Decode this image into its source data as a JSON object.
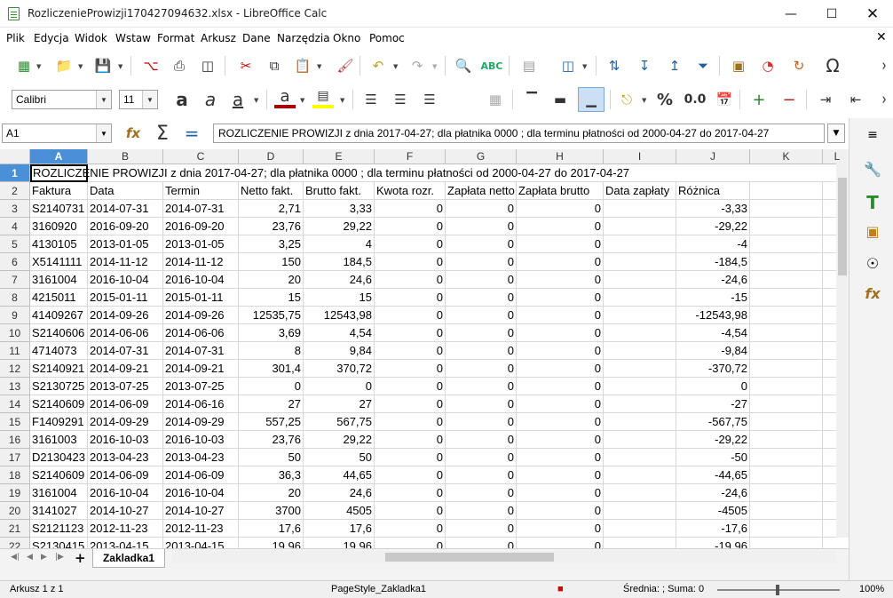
{
  "window": {
    "title": "RozliczenieProwizji170427094632.xlsx - LibreOffice Calc"
  },
  "menu": [
    "Plik",
    "Edycja",
    "Widok",
    "Wstaw",
    "Format",
    "Arkusz",
    "Dane",
    "Narzędzia",
    "Okno",
    "Pomoc"
  ],
  "font": {
    "name": "Calibri",
    "size": "11"
  },
  "namebox": "A1",
  "formula": "ROZLICZENIE PROWIZJI z dnia 2017-04-27; dla płatnika 0000 ; dla terminu płatności od 2000-04-27 do 2017-04-27",
  "columns": [
    "A",
    "B",
    "C",
    "D",
    "E",
    "F",
    "G",
    "H",
    "I",
    "J",
    "K",
    "L"
  ],
  "row1_text": "ROZLICZENIE PROWIZJI z dnia 2017-04-27; dla płatnika 0000 ; dla terminu płatności od 2000-04-27 do 2017-04-27",
  "headers": [
    "Faktura",
    "Data",
    "Termin",
    "Netto fakt.",
    "Brutto fakt.",
    "Kwota rozr.",
    "Zapłata netto",
    "Zapłata brutto",
    "Data zapłaty",
    "Różnica"
  ],
  "rows": [
    [
      "S2140731",
      "2014-07-31",
      "2014-07-31",
      "2,71",
      "3,33",
      "0",
      "0",
      "0",
      "",
      "-3,33"
    ],
    [
      "3160920",
      "2016-09-20",
      "2016-09-20",
      "23,76",
      "29,22",
      "0",
      "0",
      "0",
      "",
      "-29,22"
    ],
    [
      "4130105",
      "2013-01-05",
      "2013-01-05",
      "3,25",
      "4",
      "0",
      "0",
      "0",
      "",
      "-4"
    ],
    [
      "X5141111",
      "2014-11-12",
      "2014-11-12",
      "150",
      "184,5",
      "0",
      "0",
      "0",
      "",
      "-184,5"
    ],
    [
      "3161004",
      "2016-10-04",
      "2016-10-04",
      "20",
      "24,6",
      "0",
      "0",
      "0",
      "",
      "-24,6"
    ],
    [
      "4215011",
      "2015-01-11",
      "2015-01-11",
      "15",
      "15",
      "0",
      "0",
      "0",
      "",
      "-15"
    ],
    [
      "41409267",
      "2014-09-26",
      "2014-09-26",
      "12535,75",
      "12543,98",
      "0",
      "0",
      "0",
      "",
      "-12543,98"
    ],
    [
      "S2140606",
      "2014-06-06",
      "2014-06-06",
      "3,69",
      "4,54",
      "0",
      "0",
      "0",
      "",
      "-4,54"
    ],
    [
      "4714073",
      "2014-07-31",
      "2014-07-31",
      "8",
      "9,84",
      "0",
      "0",
      "0",
      "",
      "-9,84"
    ],
    [
      "S2140921",
      "2014-09-21",
      "2014-09-21",
      "301,4",
      "370,72",
      "0",
      "0",
      "0",
      "",
      "-370,72"
    ],
    [
      "S2130725",
      "2013-07-25",
      "2013-07-25",
      "0",
      "0",
      "0",
      "0",
      "0",
      "",
      "0"
    ],
    [
      "S2140609",
      "2014-06-09",
      "2014-06-16",
      "27",
      "27",
      "0",
      "0",
      "0",
      "",
      "-27"
    ],
    [
      "F1409291",
      "2014-09-29",
      "2014-09-29",
      "557,25",
      "567,75",
      "0",
      "0",
      "0",
      "",
      "-567,75"
    ],
    [
      "3161003",
      "2016-10-03",
      "2016-10-03",
      "23,76",
      "29,22",
      "0",
      "0",
      "0",
      "",
      "-29,22"
    ],
    [
      "D2130423",
      "2013-04-23",
      "2013-04-23",
      "50",
      "50",
      "0",
      "0",
      "0",
      "",
      "-50"
    ],
    [
      "S2140609",
      "2014-06-09",
      "2014-06-09",
      "36,3",
      "44,65",
      "0",
      "0",
      "0",
      "",
      "-44,65"
    ],
    [
      "3161004",
      "2016-10-04",
      "2016-10-04",
      "20",
      "24,6",
      "0",
      "0",
      "0",
      "",
      "-24,6"
    ],
    [
      "3141027",
      "2014-10-27",
      "2014-10-27",
      "3700",
      "4505",
      "0",
      "0",
      "0",
      "",
      "-4505"
    ],
    [
      "S2121123",
      "2012-11-23",
      "2012-11-23",
      "17,6",
      "17,6",
      "0",
      "0",
      "0",
      "",
      "-17,6"
    ],
    [
      "S2130415",
      "2013-04-15",
      "2013-04-15",
      "19,96",
      "19,96",
      "0",
      "0",
      "0",
      "",
      "-19,96"
    ]
  ],
  "sheet_tab": "Zakladka1",
  "status": {
    "sheet": "Arkusz 1 z 1",
    "pagestyle": "PageStyle_Zakladka1",
    "sum": "Średnia: ; Suma: 0",
    "zoom": "100%"
  }
}
